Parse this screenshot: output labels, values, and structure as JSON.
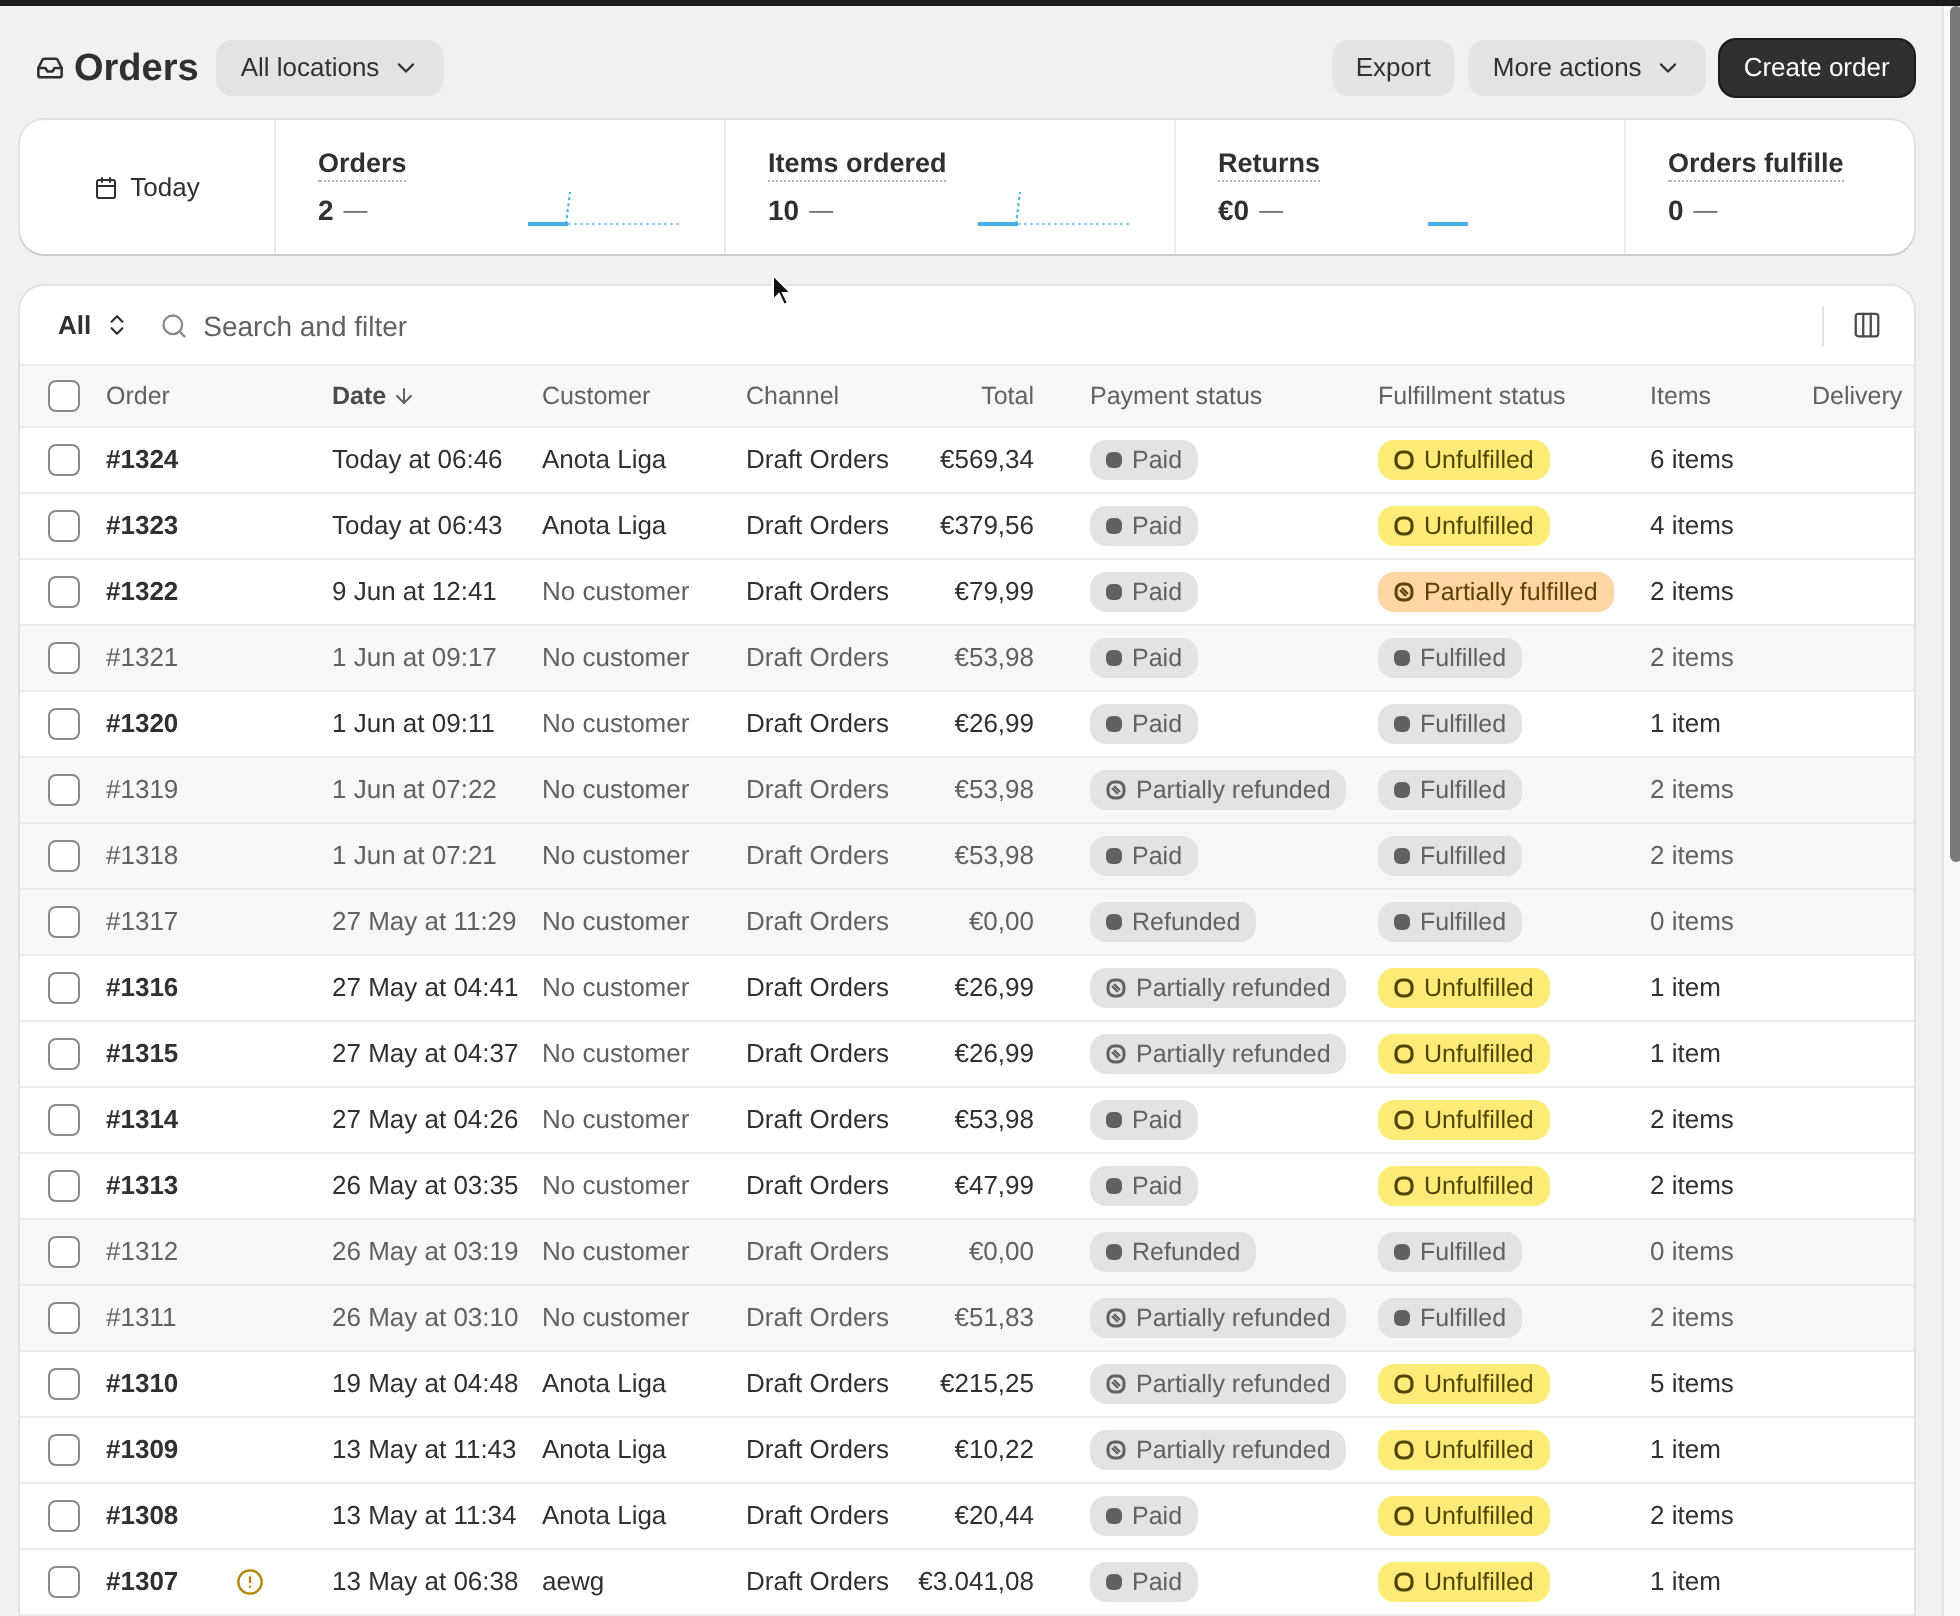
{
  "header": {
    "title": "Orders",
    "location_button": "All locations",
    "actions": [
      {
        "label": "Export",
        "kind": "secondary"
      },
      {
        "label": "More actions",
        "kind": "menu"
      },
      {
        "label": "Create order",
        "kind": "primary"
      }
    ]
  },
  "metrics": {
    "date_range": "Today",
    "items": [
      {
        "label": "Orders",
        "value": "2",
        "trend": "—",
        "kind": "rise"
      },
      {
        "label": "Items ordered",
        "value": "10",
        "trend": "—",
        "kind": "rise"
      },
      {
        "label": "Returns",
        "value": "€0",
        "trend": "—",
        "kind": "flat"
      },
      {
        "label": "Orders fulfille",
        "value": "0",
        "trend": "—",
        "kind": "hidden"
      }
    ]
  },
  "toolbar": {
    "view": "All",
    "search": {
      "placeholder": "Search and filter"
    }
  },
  "table": {
    "select_all": {
      "checked": false
    },
    "columns": [
      {
        "label": "Order",
        "sorted": false
      },
      {
        "label": "Date",
        "sorted": true
      },
      {
        "label": "Customer",
        "sorted": false
      },
      {
        "label": "Channel",
        "sorted": false
      },
      {
        "label": "Total",
        "sorted": false
      },
      {
        "label": "Payment status",
        "sorted": false
      },
      {
        "label": "Fulfillment status",
        "sorted": false
      },
      {
        "label": "Items",
        "sorted": false
      },
      {
        "label": "Delivery",
        "sorted": false
      }
    ],
    "rows": [
      {
        "order": "#1324",
        "flagged": false,
        "date": "Today at 06:46",
        "customer": "Anota Liga",
        "customer_missing": false,
        "channel": "Draft Orders",
        "total": "€569,34",
        "payment": {
          "label": "Paid",
          "kind": "complete"
        },
        "fulfillment": {
          "label": "Unfulfilled",
          "kind": "incomplete"
        },
        "items": "6 items",
        "closed": false,
        "selected": false
      },
      {
        "order": "#1323",
        "flagged": false,
        "date": "Today at 06:43",
        "customer": "Anota Liga",
        "customer_missing": false,
        "channel": "Draft Orders",
        "total": "€379,56",
        "payment": {
          "label": "Paid",
          "kind": "complete"
        },
        "fulfillment": {
          "label": "Unfulfilled",
          "kind": "incomplete"
        },
        "items": "4 items",
        "closed": false,
        "selected": false
      },
      {
        "order": "#1322",
        "flagged": false,
        "date": "9 Jun at 12:41",
        "customer": "No customer",
        "customer_missing": true,
        "channel": "Draft Orders",
        "total": "€79,99",
        "payment": {
          "label": "Paid",
          "kind": "complete"
        },
        "fulfillment": {
          "label": "Partially fulfilled",
          "kind": "partial"
        },
        "items": "2 items",
        "closed": false,
        "selected": false
      },
      {
        "order": "#1321",
        "flagged": false,
        "date": "1 Jun at 09:17",
        "customer": "No customer",
        "customer_missing": true,
        "channel": "Draft Orders",
        "total": "€53,98",
        "payment": {
          "label": "Paid",
          "kind": "complete"
        },
        "fulfillment": {
          "label": "Fulfilled",
          "kind": "complete"
        },
        "items": "2 items",
        "closed": true,
        "selected": false
      },
      {
        "order": "#1320",
        "flagged": false,
        "date": "1 Jun at 09:11",
        "customer": "No customer",
        "customer_missing": true,
        "channel": "Draft Orders",
        "total": "€26,99",
        "payment": {
          "label": "Paid",
          "kind": "complete"
        },
        "fulfillment": {
          "label": "Fulfilled",
          "kind": "complete"
        },
        "items": "1 item",
        "closed": false,
        "selected": false
      },
      {
        "order": "#1319",
        "flagged": false,
        "date": "1 Jun at 07:22",
        "customer": "No customer",
        "customer_missing": true,
        "channel": "Draft Orders",
        "total": "€53,98",
        "payment": {
          "label": "Partially refunded",
          "kind": "partial"
        },
        "fulfillment": {
          "label": "Fulfilled",
          "kind": "complete"
        },
        "items": "2 items",
        "closed": true,
        "selected": false
      },
      {
        "order": "#1318",
        "flagged": false,
        "date": "1 Jun at 07:21",
        "customer": "No customer",
        "customer_missing": true,
        "channel": "Draft Orders",
        "total": "€53,98",
        "payment": {
          "label": "Paid",
          "kind": "complete"
        },
        "fulfillment": {
          "label": "Fulfilled",
          "kind": "complete"
        },
        "items": "2 items",
        "closed": true,
        "selected": false
      },
      {
        "order": "#1317",
        "flagged": false,
        "date": "27 May at 11:29",
        "customer": "No customer",
        "customer_missing": true,
        "channel": "Draft Orders",
        "total": "€0,00",
        "payment": {
          "label": "Refunded",
          "kind": "complete"
        },
        "fulfillment": {
          "label": "Fulfilled",
          "kind": "complete"
        },
        "items": "0 items",
        "closed": true,
        "selected": false
      },
      {
        "order": "#1316",
        "flagged": false,
        "date": "27 May at 04:41",
        "customer": "No customer",
        "customer_missing": true,
        "channel": "Draft Orders",
        "total": "€26,99",
        "payment": {
          "label": "Partially refunded",
          "kind": "partial"
        },
        "fulfillment": {
          "label": "Unfulfilled",
          "kind": "incomplete"
        },
        "items": "1 item",
        "closed": false,
        "selected": false
      },
      {
        "order": "#1315",
        "flagged": false,
        "date": "27 May at 04:37",
        "customer": "No customer",
        "customer_missing": true,
        "channel": "Draft Orders",
        "total": "€26,99",
        "payment": {
          "label": "Partially refunded",
          "kind": "partial"
        },
        "fulfillment": {
          "label": "Unfulfilled",
          "kind": "incomplete"
        },
        "items": "1 item",
        "closed": false,
        "selected": false
      },
      {
        "order": "#1314",
        "flagged": false,
        "date": "27 May at 04:26",
        "customer": "No customer",
        "customer_missing": true,
        "channel": "Draft Orders",
        "total": "€53,98",
        "payment": {
          "label": "Paid",
          "kind": "complete"
        },
        "fulfillment": {
          "label": "Unfulfilled",
          "kind": "incomplete"
        },
        "items": "2 items",
        "closed": false,
        "selected": false
      },
      {
        "order": "#1313",
        "flagged": false,
        "date": "26 May at 03:35",
        "customer": "No customer",
        "customer_missing": true,
        "channel": "Draft Orders",
        "total": "€47,99",
        "payment": {
          "label": "Paid",
          "kind": "complete"
        },
        "fulfillment": {
          "label": "Unfulfilled",
          "kind": "incomplete"
        },
        "items": "2 items",
        "closed": false,
        "selected": false
      },
      {
        "order": "#1312",
        "flagged": false,
        "date": "26 May at 03:19",
        "customer": "No customer",
        "customer_missing": true,
        "channel": "Draft Orders",
        "total": "€0,00",
        "payment": {
          "label": "Refunded",
          "kind": "complete"
        },
        "fulfillment": {
          "label": "Fulfilled",
          "kind": "complete"
        },
        "items": "0 items",
        "closed": true,
        "selected": false
      },
      {
        "order": "#1311",
        "flagged": false,
        "date": "26 May at 03:10",
        "customer": "No customer",
        "customer_missing": true,
        "channel": "Draft Orders",
        "total": "€51,83",
        "payment": {
          "label": "Partially refunded",
          "kind": "partial"
        },
        "fulfillment": {
          "label": "Fulfilled",
          "kind": "complete"
        },
        "items": "2 items",
        "closed": true,
        "selected": false
      },
      {
        "order": "#1310",
        "flagged": false,
        "date": "19 May at 04:48",
        "customer": "Anota Liga",
        "customer_missing": false,
        "channel": "Draft Orders",
        "total": "€215,25",
        "payment": {
          "label": "Partially refunded",
          "kind": "partial"
        },
        "fulfillment": {
          "label": "Unfulfilled",
          "kind": "incomplete"
        },
        "items": "5 items",
        "closed": false,
        "selected": false
      },
      {
        "order": "#1309",
        "flagged": false,
        "date": "13 May at 11:43",
        "customer": "Anota Liga",
        "customer_missing": false,
        "channel": "Draft Orders",
        "total": "€10,22",
        "payment": {
          "label": "Partially refunded",
          "kind": "partial"
        },
        "fulfillment": {
          "label": "Unfulfilled",
          "kind": "incomplete"
        },
        "items": "1 item",
        "closed": false,
        "selected": false
      },
      {
        "order": "#1308",
        "flagged": false,
        "date": "13 May at 11:34",
        "customer": "Anota Liga",
        "customer_missing": false,
        "channel": "Draft Orders",
        "total": "€20,44",
        "payment": {
          "label": "Paid",
          "kind": "complete"
        },
        "fulfillment": {
          "label": "Unfulfilled",
          "kind": "incomplete"
        },
        "items": "2 items",
        "closed": false,
        "selected": false
      },
      {
        "order": "#1307",
        "flagged": true,
        "date": "13 May at 06:38",
        "customer": "aewg",
        "customer_missing": false,
        "channel": "Draft Orders",
        "total": "€3.041,08",
        "payment": {
          "label": "Paid",
          "kind": "complete"
        },
        "fulfillment": {
          "label": "Unfulfilled",
          "kind": "incomplete"
        },
        "items": "1 item",
        "closed": false,
        "selected": false
      }
    ]
  }
}
